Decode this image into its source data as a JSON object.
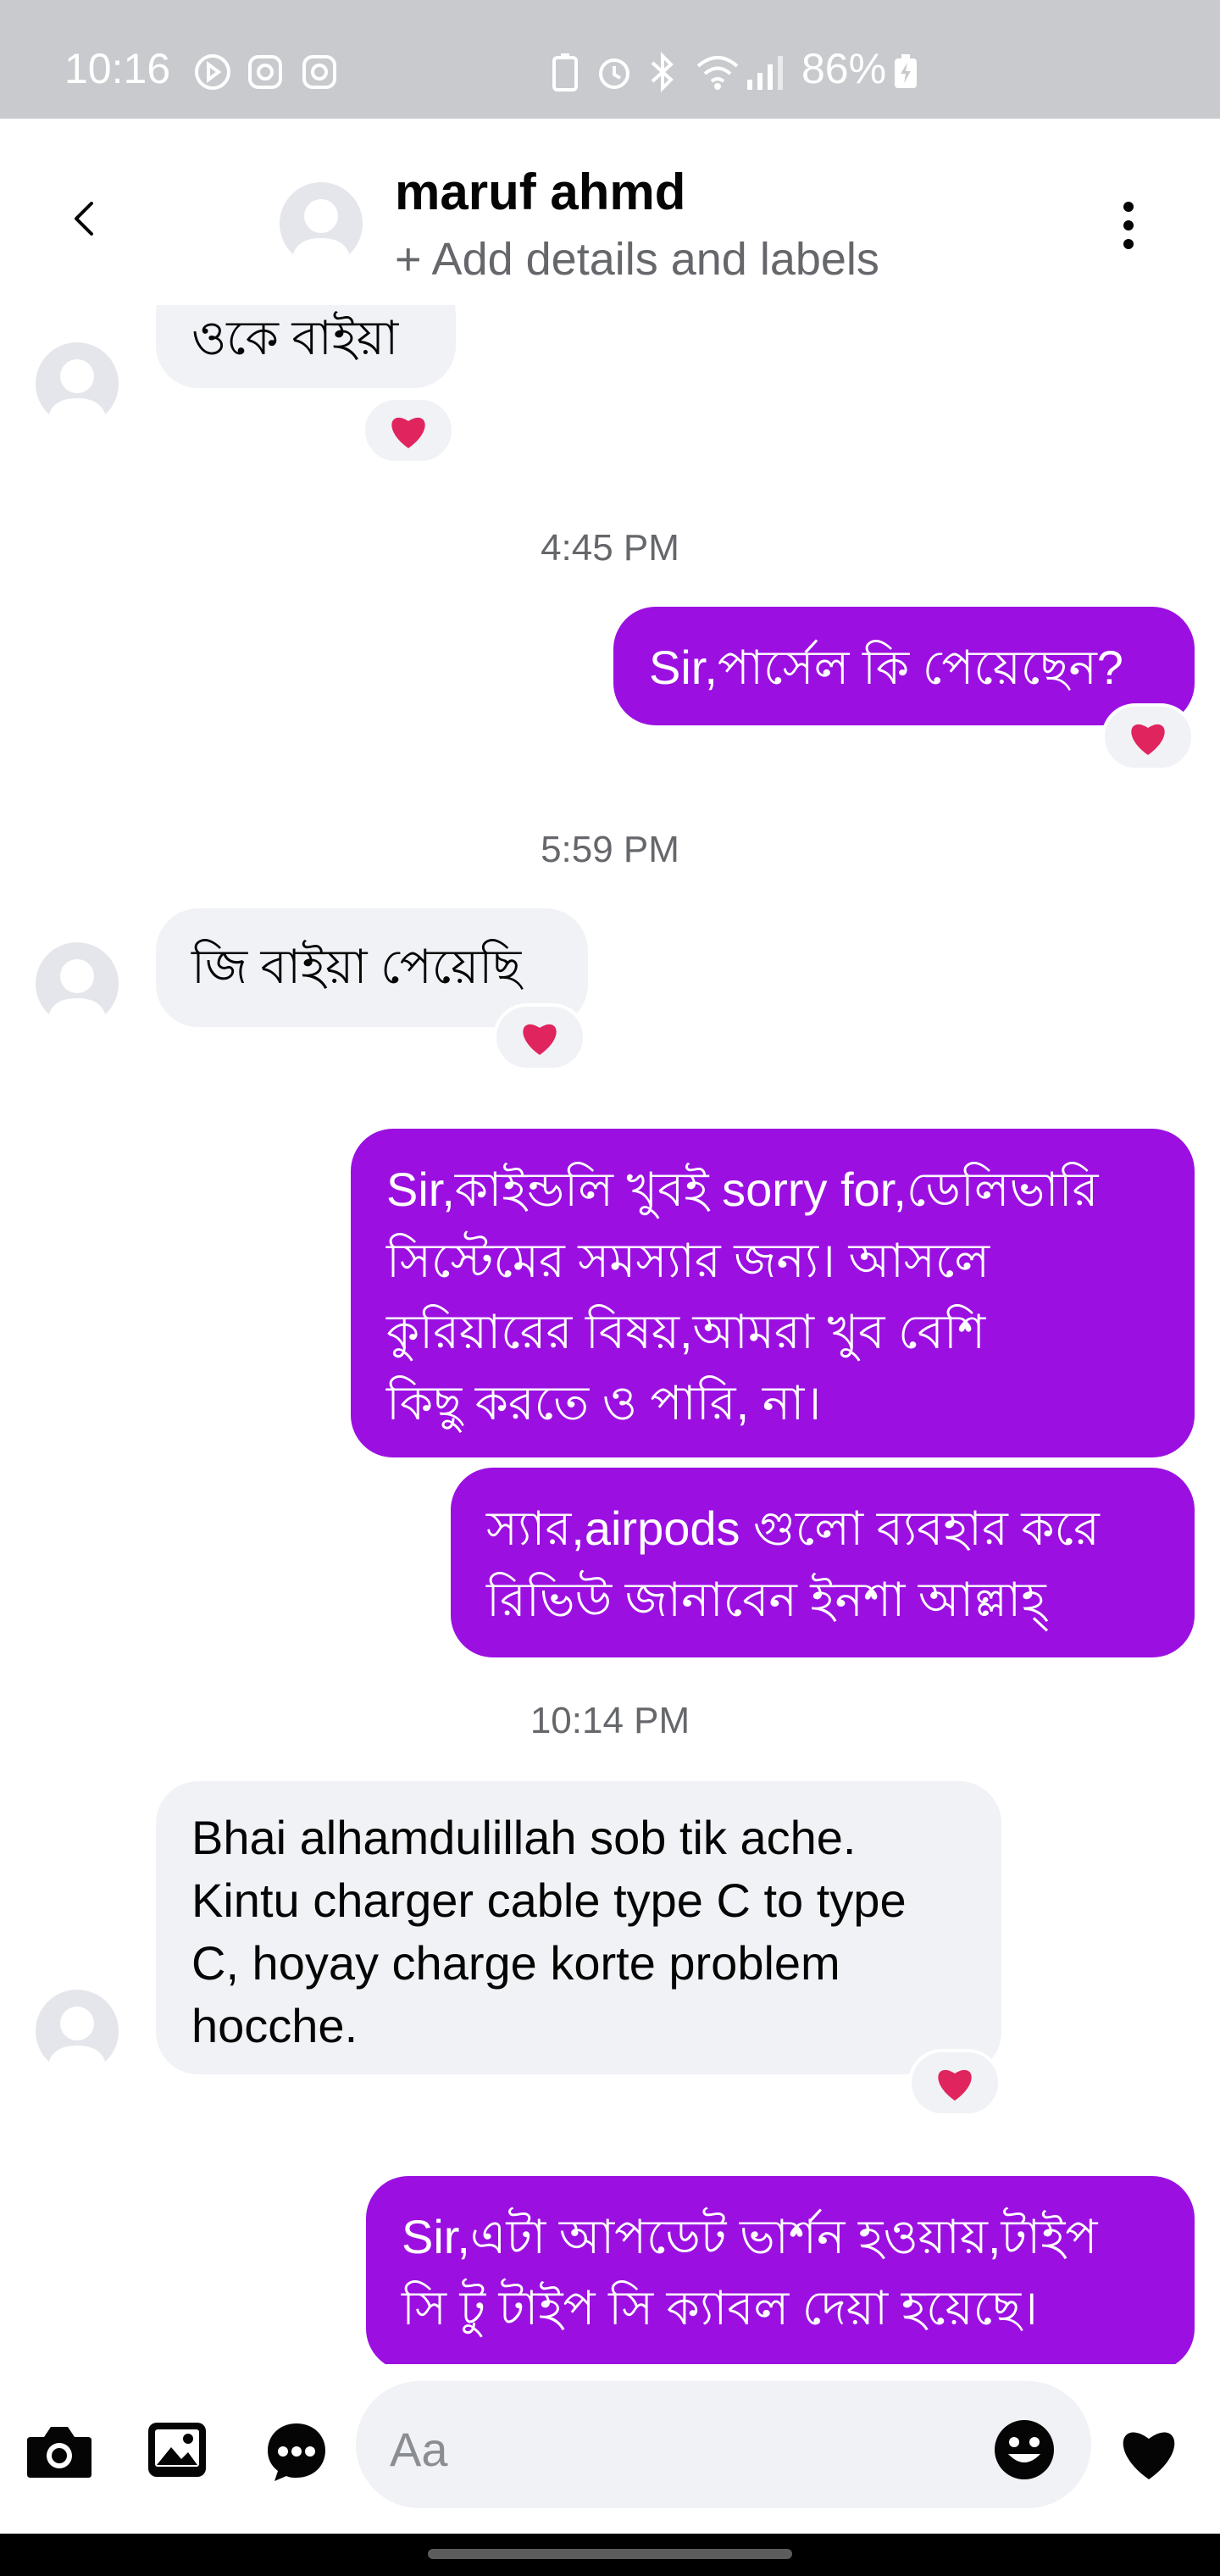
{
  "status_bar": {
    "time": "10:16",
    "battery": "86%",
    "icons": [
      "navigation-icon",
      "instagram-icon",
      "instagram-icon",
      "battery-saver-icon",
      "alarm-icon",
      "bluetooth-icon",
      "wifi-icon",
      "signal-icon",
      "charging-battery-icon"
    ]
  },
  "header": {
    "name": "maruf ahmd",
    "subtitle": "+ Add details and labels"
  },
  "messages": [
    {
      "dir": "in",
      "text": "ওকে বাইয়া",
      "reaction": "❤️"
    },
    {
      "timestamp": "4:45 PM"
    },
    {
      "dir": "out",
      "text": "Sir,পার্সেল কি পেয়েছেন?",
      "reaction": "❤️"
    },
    {
      "timestamp": "5:59 PM"
    },
    {
      "dir": "in",
      "text": "জি বাইয়া পেয়েছি",
      "reaction": "❤️"
    },
    {
      "dir": "out",
      "lines": [
        "Sir,কাইন্ডলি খুবই sorry for,ডেলিভারি",
        "সিস্টেমের সমস্যার জন্য। আসলে",
        "কুরিয়ারের বিষয়,আমরা খুব বেশি",
        "কিছু করতে ও পারি, না।"
      ]
    },
    {
      "dir": "out",
      "lines": [
        "স্যার,airpods গুলো ব্যবহার করে",
        "রিভিউ জানাবেন ইনশা আল্লাহ্"
      ]
    },
    {
      "timestamp": "10:14 PM"
    },
    {
      "dir": "in",
      "lines": [
        "Bhai alhamdulillah sob tik ache.",
        "Kintu charger cable type C to type",
        "C, hoyay charge korte problem",
        "hocche."
      ],
      "reaction": "❤️"
    },
    {
      "dir": "out",
      "lines": [
        "Sir,এটা আপডেট ভার্শন হওয়ায়,টাইপ",
        "সি টু টাইপ সি ক্যাবল দেয়া হয়েছে।"
      ]
    }
  ],
  "composer": {
    "placeholder": "Aa",
    "icons": [
      "camera-icon",
      "gallery-icon",
      "chat-bubble-icon",
      "emoji-icon",
      "heart-icon"
    ]
  },
  "colors": {
    "outgoing_bubble": "#9b10e1",
    "incoming_bubble": "#f0f2f5",
    "reaction_heart": "#e0245e"
  }
}
